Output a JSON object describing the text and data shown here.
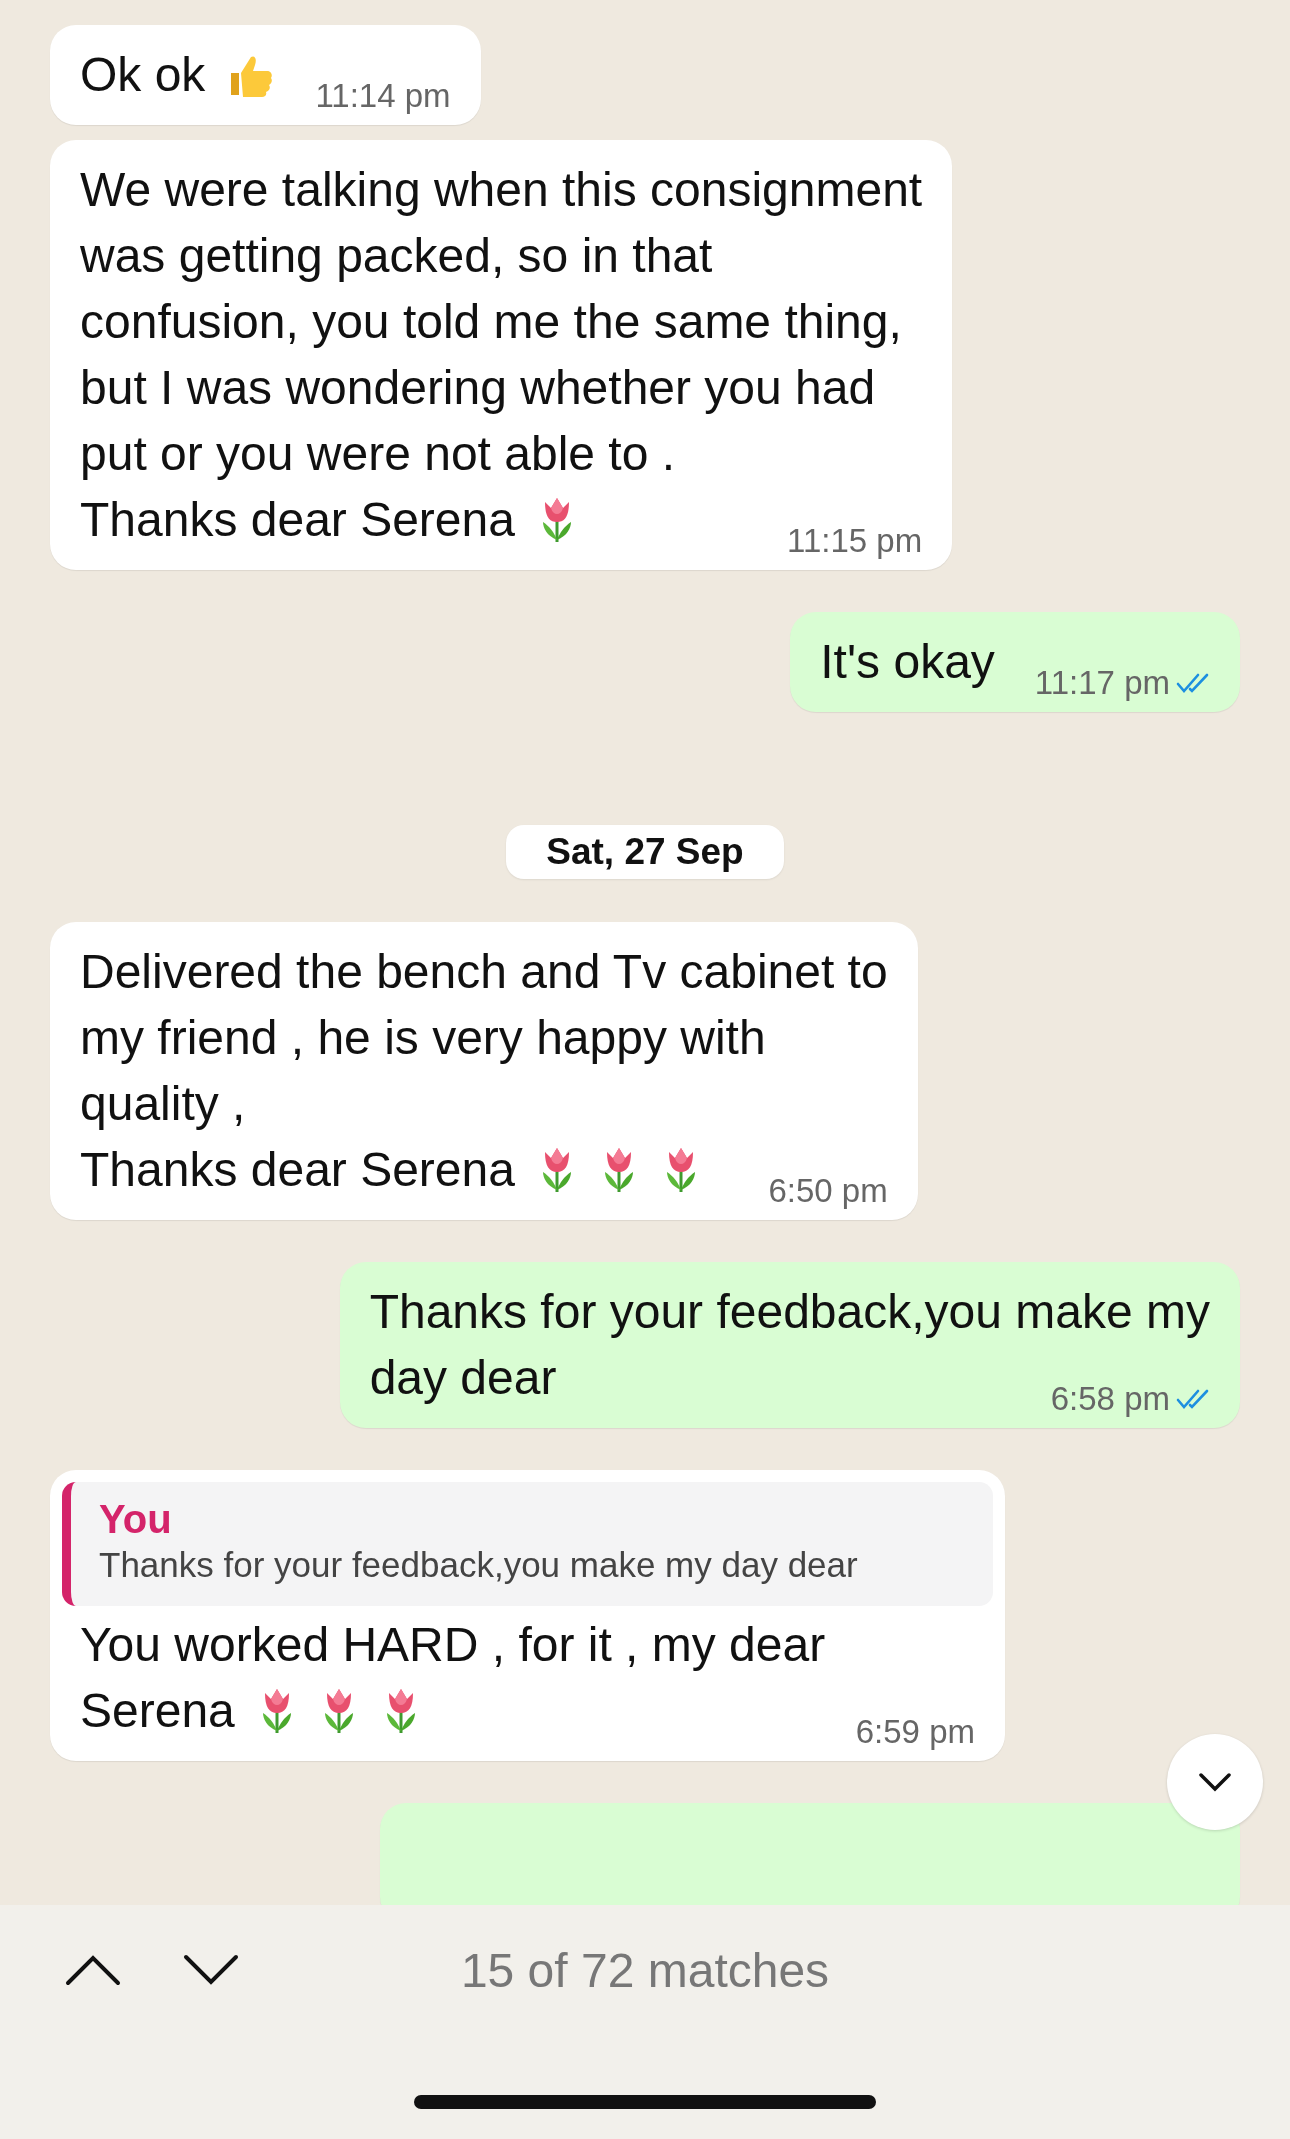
{
  "messages": [
    {
      "kind": "text",
      "outgoing": false,
      "lines": [
        "Ok ok"
      ],
      "emojis": [
        {
          "kind": "thumbs_up"
        }
      ],
      "time": "11:14 pm"
    },
    {
      "kind": "text",
      "outgoing": false,
      "lines": [
        "We were talking when this consignment",
        "was getting packed, so in that",
        "confusion, you told me the same thing,",
        "but I was wondering whether you had",
        "put or you were not able to .",
        "Thanks dear Serena"
      ],
      "emojis": [
        {
          "kind": "tulip"
        }
      ],
      "time": "11:15 pm"
    },
    {
      "kind": "text",
      "outgoing": true,
      "lines": [
        "It's okay"
      ],
      "time": "11:17 pm",
      "read": true
    },
    {
      "kind": "date",
      "text": "Sat, 27 Sep"
    },
    {
      "kind": "text",
      "outgoing": false,
      "lines": [
        "Delivered the bench and Tv cabinet to",
        "my friend , he is very happy with",
        "quality ,",
        "Thanks dear Serena"
      ],
      "emojis": [
        {
          "kind": "tulip"
        },
        {
          "kind": "tulip"
        },
        {
          "kind": "tulip"
        }
      ],
      "time": "6:50 pm"
    },
    {
      "kind": "text",
      "outgoing": true,
      "lines": [
        "Thanks for your feedback,you make my",
        "day dear"
      ],
      "time": "6:58 pm",
      "read": true
    },
    {
      "kind": "reply",
      "outgoing": false,
      "quote": {
        "author": "You",
        "text": "Thanks for your feedback,you make my day dear"
      },
      "lines": [
        "You worked HARD , for it , my dear",
        "Serena"
      ],
      "emojis": [
        {
          "kind": "tulip"
        },
        {
          "kind": "tulip"
        },
        {
          "kind": "tulip"
        }
      ],
      "time": "6:59 pm"
    },
    {
      "kind": "partial",
      "outgoing": true
    }
  ],
  "search_bar": {
    "result": "15 of 72 matches"
  }
}
